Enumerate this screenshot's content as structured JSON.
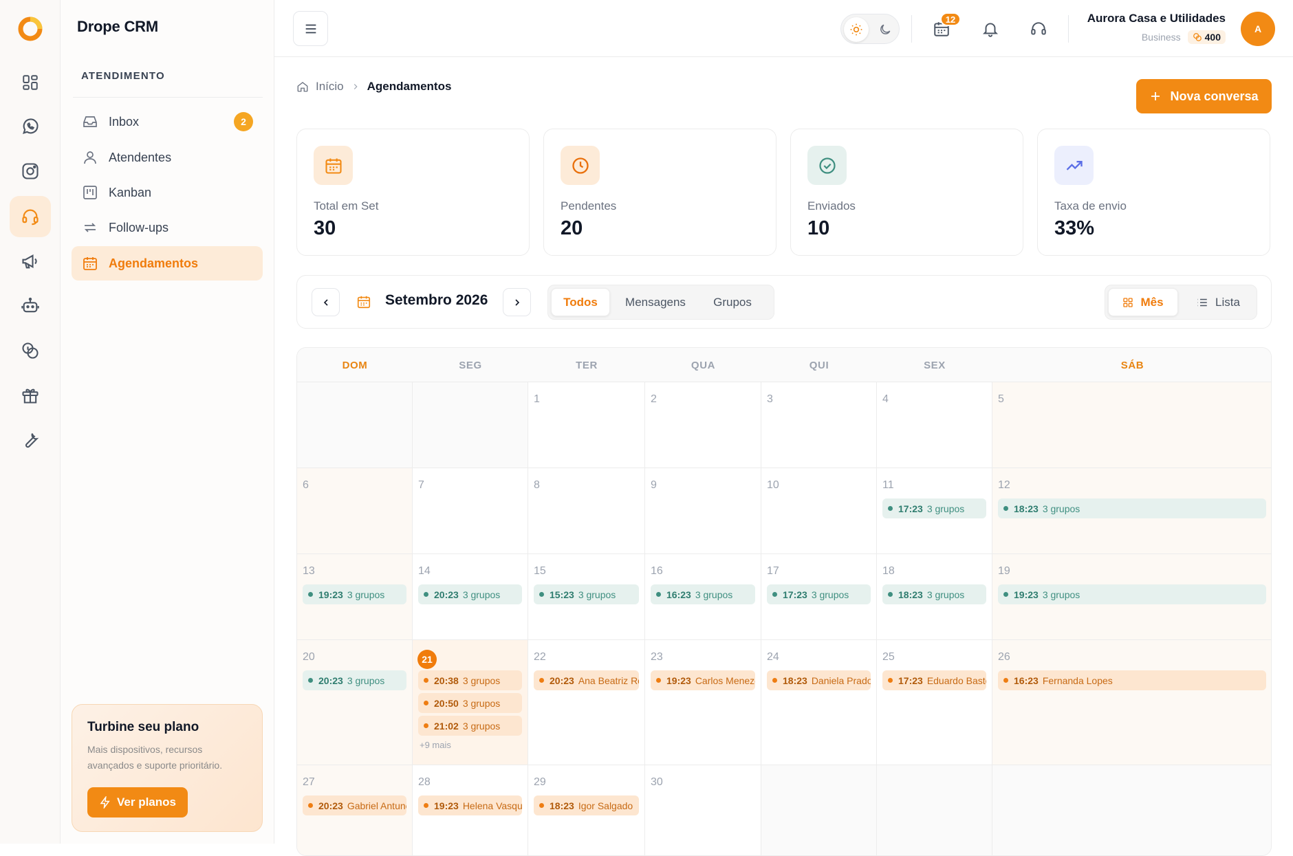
{
  "brand": "Drope CRM",
  "sidebar": {
    "section": "ATENDIMENTO",
    "items": [
      {
        "label": "Inbox",
        "badge": "2"
      },
      {
        "label": "Atendentes"
      },
      {
        "label": "Kanban"
      },
      {
        "label": "Follow-ups"
      },
      {
        "label": "Agendamentos",
        "active": true
      }
    ],
    "promo": {
      "title": "Turbine seu plano",
      "text": "Mais dispositivos, recursos avançados e suporte prioritário.",
      "button": "Ver planos"
    }
  },
  "topbar": {
    "calendar_count": "12",
    "user_name": "Aurora Casa e Utilidades",
    "plan": "Business",
    "credits": "400",
    "avatar_initial": "A"
  },
  "breadcrumb": {
    "home": "Início",
    "current": "Agendamentos"
  },
  "new_conversation": "Nova conversa",
  "stats": [
    {
      "label": "Total em Set",
      "value": "30"
    },
    {
      "label": "Pendentes",
      "value": "20"
    },
    {
      "label": "Enviados",
      "value": "10"
    },
    {
      "label": "Taxa de envio",
      "value": "33%"
    }
  ],
  "toolbar": {
    "month": "Setembro 2026",
    "filters": [
      "Todos",
      "Mensagens",
      "Grupos"
    ],
    "views": [
      "Mês",
      "Lista"
    ]
  },
  "calendar": {
    "weekdays": [
      "DOM",
      "SEG",
      "TER",
      "QUA",
      "QUI",
      "SEX",
      "SÁB"
    ],
    "weeks": [
      [
        null,
        null,
        {
          "d": "1",
          "ev": []
        },
        {
          "d": "2",
          "ev": []
        },
        {
          "d": "3",
          "ev": []
        },
        {
          "d": "4",
          "ev": []
        },
        {
          "d": "5",
          "ev": []
        }
      ],
      [
        {
          "d": "6",
          "ev": []
        },
        {
          "d": "7",
          "ev": []
        },
        {
          "d": "8",
          "ev": []
        },
        {
          "d": "9",
          "ev": []
        },
        {
          "d": "10",
          "ev": []
        },
        {
          "d": "11",
          "ev": [
            {
              "time": "17:23",
              "label": "3 grupos",
              "kind": "g"
            }
          ]
        },
        {
          "d": "12",
          "ev": [
            {
              "time": "18:23",
              "label": "3 grupos",
              "kind": "g"
            }
          ]
        }
      ],
      [
        {
          "d": "13",
          "ev": [
            {
              "time": "19:23",
              "label": "3 grupos",
              "kind": "g"
            }
          ]
        },
        {
          "d": "14",
          "ev": [
            {
              "time": "20:23",
              "label": "3 grupos",
              "kind": "g"
            }
          ]
        },
        {
          "d": "15",
          "ev": [
            {
              "time": "15:23",
              "label": "3 grupos",
              "kind": "g"
            }
          ]
        },
        {
          "d": "16",
          "ev": [
            {
              "time": "16:23",
              "label": "3 grupos",
              "kind": "g"
            }
          ]
        },
        {
          "d": "17",
          "ev": [
            {
              "time": "17:23",
              "label": "3 grupos",
              "kind": "g"
            }
          ]
        },
        {
          "d": "18",
          "ev": [
            {
              "time": "18:23",
              "label": "3 grupos",
              "kind": "g"
            }
          ]
        },
        {
          "d": "19",
          "ev": [
            {
              "time": "19:23",
              "label": "3 grupos",
              "kind": "g"
            }
          ]
        }
      ],
      [
        {
          "d": "20",
          "ev": [
            {
              "time": "20:23",
              "label": "3 grupos",
              "kind": "g"
            }
          ]
        },
        {
          "d": "21",
          "today": true,
          "ev": [
            {
              "time": "20:38",
              "label": "3 grupos",
              "kind": "o"
            },
            {
              "time": "20:50",
              "label": "3 grupos",
              "kind": "o"
            },
            {
              "time": "21:02",
              "label": "3 grupos",
              "kind": "o"
            }
          ],
          "more": "+9 mais"
        },
        {
          "d": "22",
          "ev": [
            {
              "time": "20:23",
              "label": "Ana Beatriz Roch",
              "kind": "o"
            }
          ]
        },
        {
          "d": "23",
          "ev": [
            {
              "time": "19:23",
              "label": "Carlos Menezes",
              "kind": "o"
            }
          ]
        },
        {
          "d": "24",
          "ev": [
            {
              "time": "18:23",
              "label": "Daniela Prado",
              "kind": "o"
            }
          ]
        },
        {
          "d": "25",
          "ev": [
            {
              "time": "17:23",
              "label": "Eduardo Bastos",
              "kind": "o"
            }
          ]
        },
        {
          "d": "26",
          "ev": [
            {
              "time": "16:23",
              "label": "Fernanda Lopes",
              "kind": "o"
            }
          ]
        }
      ],
      [
        {
          "d": "27",
          "ev": [
            {
              "time": "20:23",
              "label": "Gabriel Antunes",
              "kind": "o"
            }
          ]
        },
        {
          "d": "28",
          "ev": [
            {
              "time": "19:23",
              "label": "Helena Vasques",
              "kind": "o"
            }
          ]
        },
        {
          "d": "29",
          "ev": [
            {
              "time": "18:23",
              "label": "Igor Salgado",
              "kind": "o"
            }
          ]
        },
        {
          "d": "30",
          "ev": []
        },
        null,
        null,
        null
      ]
    ]
  },
  "colors": {
    "accent": "#f28a14",
    "accent_light": "#fdebd8",
    "group_event": "#e6f1ee"
  }
}
